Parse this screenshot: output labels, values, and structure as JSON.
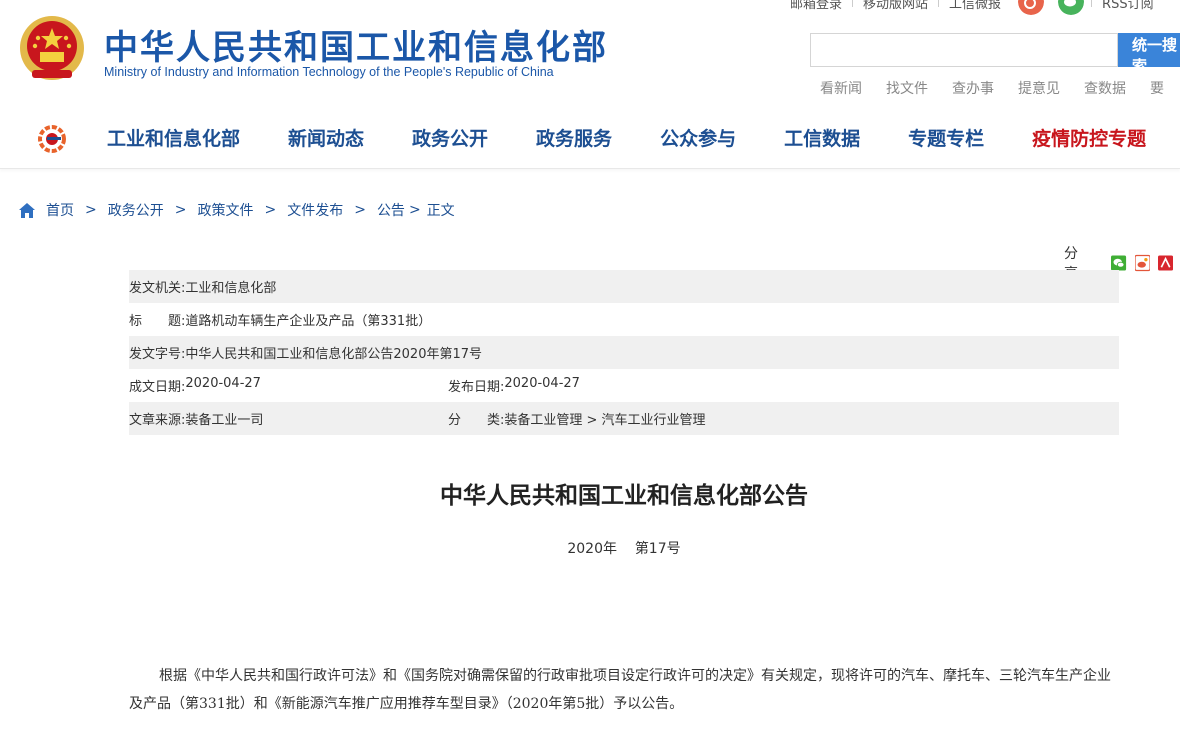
{
  "topbar": {
    "links": [
      "邮箱登录",
      "移动版网站",
      "工信微报"
    ],
    "rss": "RSS订阅",
    "colors": {
      "weibo_icon": "#e8644b",
      "wechat_icon": "#47b35c"
    }
  },
  "header": {
    "title_cn": "中华人民共和国工业和信息化部",
    "title_en": "Ministry of Industry and Information Technology of the People's Republic of China",
    "brand_color": "#1b57a8"
  },
  "search": {
    "placeholder": "",
    "button_label": "统一搜索",
    "quick_links": [
      "看新闻",
      "找文件",
      "查办事",
      "提意见",
      "查数据",
      "要"
    ]
  },
  "nav": {
    "items": [
      {
        "label": "工业和信息化部"
      },
      {
        "label": "新闻动态"
      },
      {
        "label": "政务公开"
      },
      {
        "label": "政务服务"
      },
      {
        "label": "公众参与"
      },
      {
        "label": "工信数据"
      },
      {
        "label": "专题专栏"
      },
      {
        "label": "疫情防控专题"
      }
    ],
    "color": "#1d4f92",
    "highlight_color": "#c8161d"
  },
  "breadcrumb": {
    "icon": "home-icon",
    "items": [
      "首页",
      "政务公开",
      "政策文件",
      "文件发布",
      "公告"
    ],
    "current": "正文"
  },
  "share": {
    "label": "分享:",
    "icons": [
      "wechat-share-icon",
      "weibo-share-icon",
      "other-share-icon"
    ]
  },
  "meta": {
    "issuer_label": "发文机关:",
    "issuer": "工业和信息化部",
    "title_label_1": "标",
    "title_label_2": "题:",
    "title": "道路机动车辆生产企业及产品（第331批）",
    "doc_no_label": "发文字号:",
    "doc_no": "中华人民共和国工业和信息化部公告2020年第17号",
    "written_label": "成文日期:",
    "written": "2020-04-27",
    "published_label": "发布日期:",
    "published": "2020-04-27",
    "source_label": "文章来源:",
    "source": "装备工业一司",
    "category_label_1": "分",
    "category_label_2": "类:",
    "category": "装备工业管理 > 汽车工业行业管理"
  },
  "article": {
    "title": "中华人民共和国工业和信息化部公告",
    "year": "2020年",
    "number": "第17号",
    "body": "根据《中华人民共和国行政许可法》和《国务院对确需保留的行政审批项目设定行政许可的决定》有关规定，现将许可的汽车、摩托车、三轮汽车生产企业及产品（第331批）和《新能源汽车推广应用推荐车型目录》（2020年第5批）予以公告。"
  }
}
